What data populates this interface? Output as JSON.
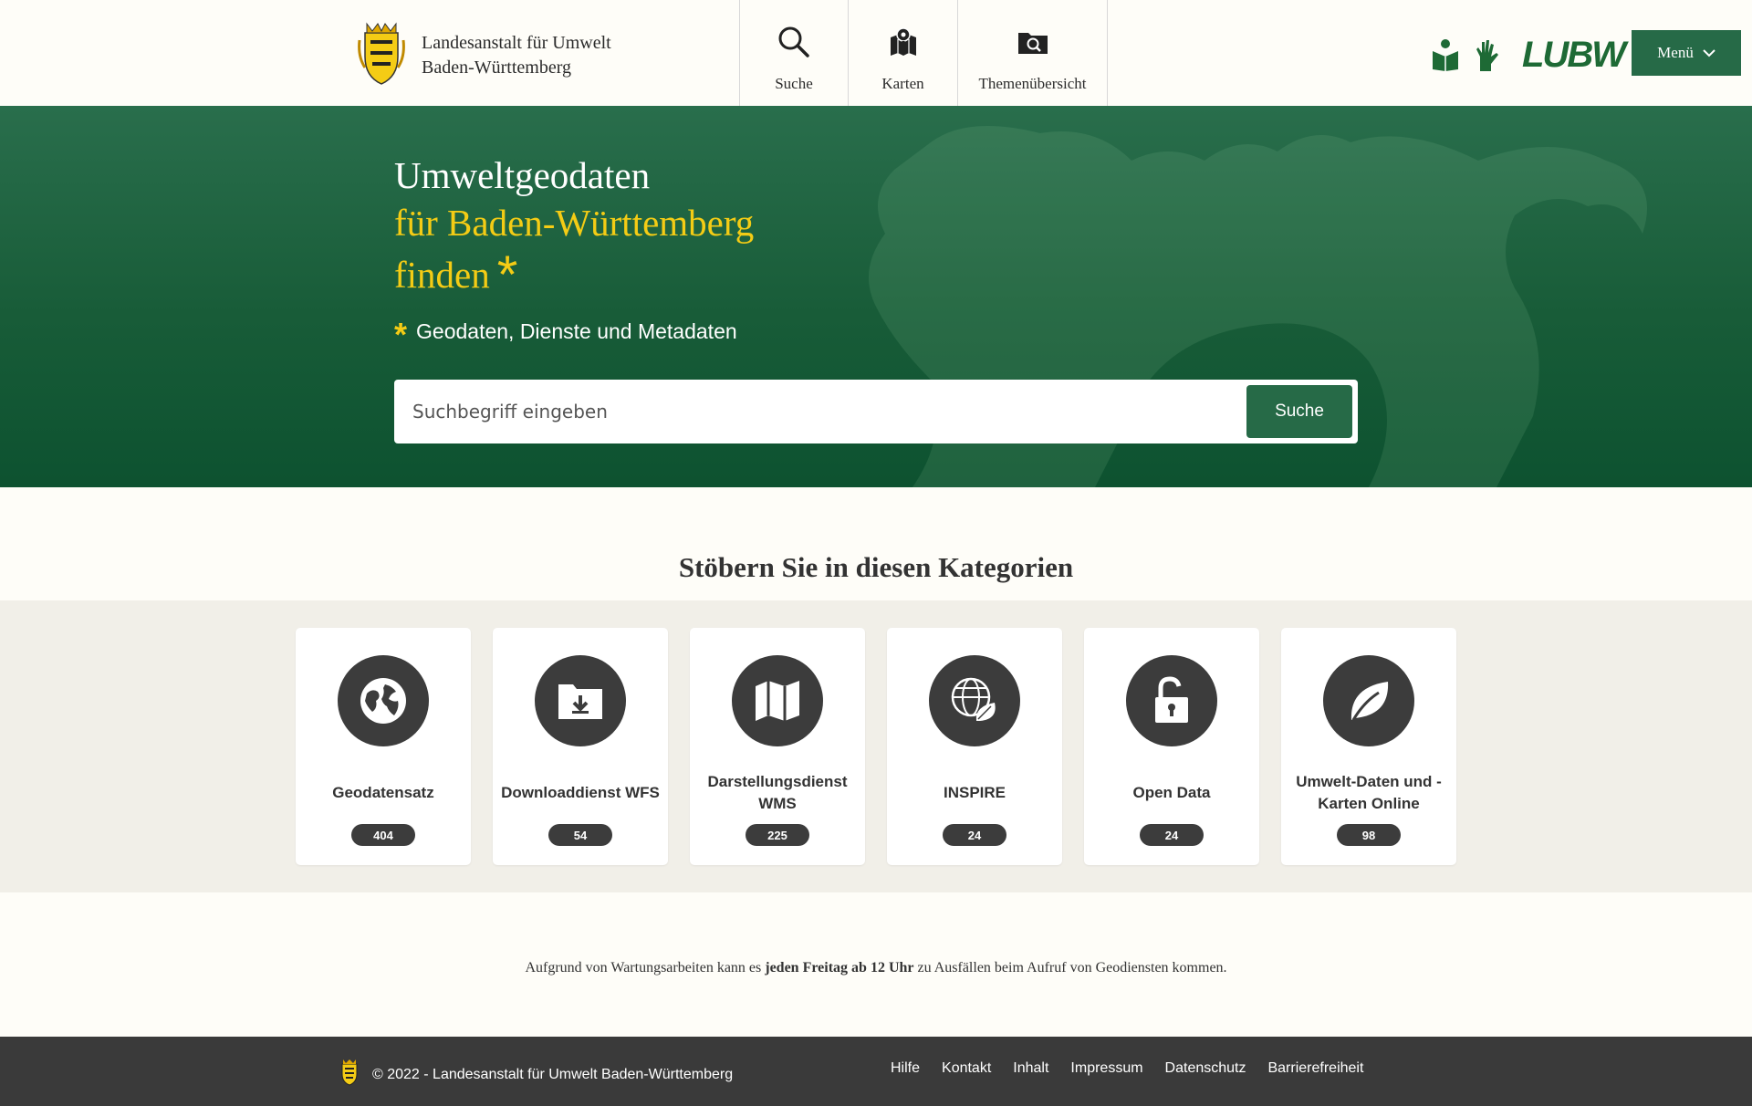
{
  "header": {
    "org_line1": "Landesanstalt für Umwelt",
    "org_line2": "Baden-Württemberg",
    "nav": [
      {
        "label": "Suche",
        "icon": "search-icon"
      },
      {
        "label": "Karten",
        "icon": "map-icon"
      },
      {
        "label": "Themenübersicht",
        "icon": "folder-search-icon"
      }
    ],
    "brand_logo_text": "LUBW",
    "menu_label": "Menü"
  },
  "hero": {
    "title_line1": "Umweltgeodaten",
    "title_line2": "für Baden-Württemberg",
    "title_line3": "finden",
    "asterisk": "*",
    "subtitle": "Geodaten, Dienste und Metadaten",
    "search_placeholder": "Suchbegriff eingeben",
    "search_button": "Suche"
  },
  "categories": {
    "heading": "Stöbern Sie in diesen Kategorien",
    "items": [
      {
        "label": "Geodatensatz",
        "count": "404",
        "icon": "globe-icon"
      },
      {
        "label": "Downloaddienst WFS",
        "count": "54",
        "icon": "folder-download-icon"
      },
      {
        "label": "Darstellungsdienst WMS",
        "count": "225",
        "icon": "map-icon"
      },
      {
        "label": "INSPIRE",
        "count": "24",
        "icon": "globe-leaf-icon"
      },
      {
        "label": "Open Data",
        "count": "24",
        "icon": "unlock-icon"
      },
      {
        "label": "Umwelt-Daten und -Karten Online",
        "count": "98",
        "icon": "leaf-icon"
      }
    ]
  },
  "notice": {
    "before": "Aufgrund von Wartungsarbeiten kann es ",
    "bold": "jeden Freitag ab 12 Uhr",
    "after": " zu Ausfällen beim Aufruf von Geodiensten kommen."
  },
  "footer": {
    "copyright": "© 2022 - Landesanstalt für Umwelt Baden-Württemberg",
    "links": [
      "Hilfe",
      "Kontakt",
      "Inhalt",
      "Impressum",
      "Datenschutz",
      "Barrierefreiheit"
    ]
  },
  "colors": {
    "primary_green": "#266a47",
    "accent_yellow": "#f4cc15",
    "dark_gray": "#3c3c3c",
    "footer_bg": "#3a3a3a"
  }
}
